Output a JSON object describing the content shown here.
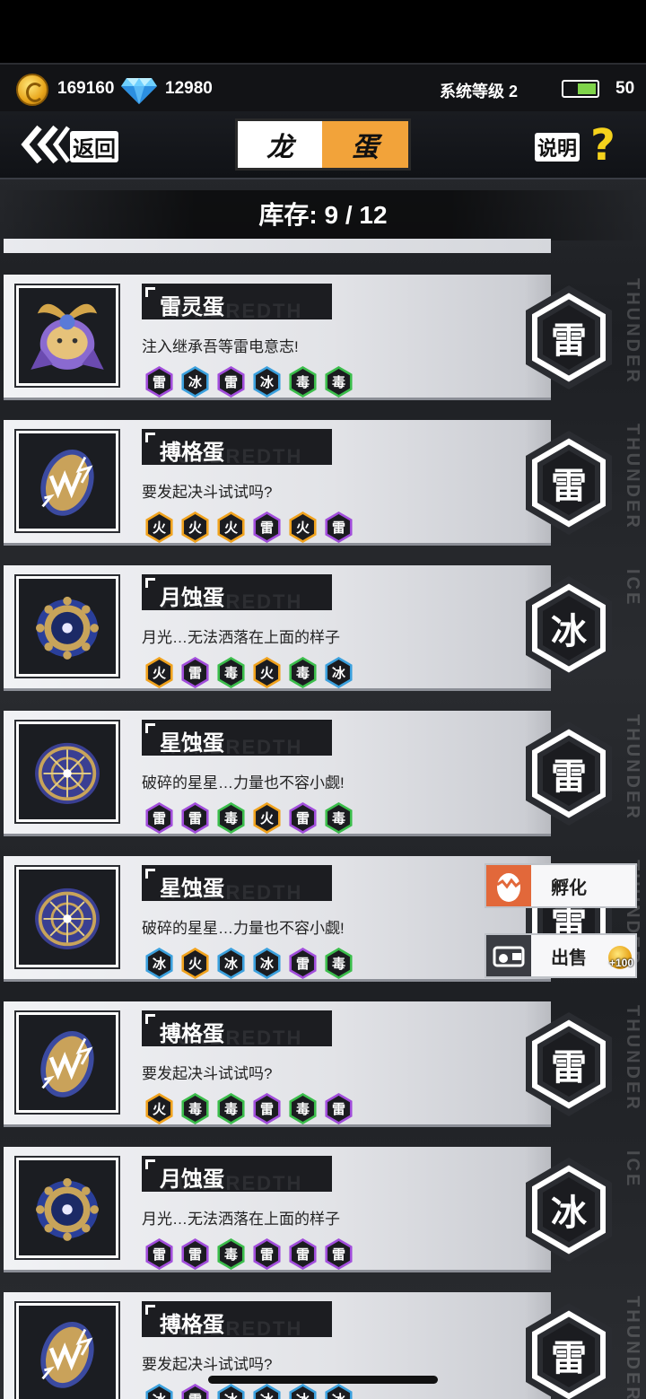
{
  "resources": {
    "coins": "169160",
    "gems": "12980",
    "system_level": "系统等级 2",
    "stamina": "50"
  },
  "nav": {
    "back_label": "返回",
    "title_left": "龙",
    "title_right": "蛋",
    "help_label": "说明",
    "help_mark": "?"
  },
  "stock": "库存: 9 / 12",
  "cards": [
    {
      "name": "雷灵蛋",
      "desc": "注入继承吾等雷电意志!",
      "attrs": [
        "雷",
        "冰",
        "雷",
        "冰",
        "毒",
        "毒"
      ],
      "element": "雷",
      "side": "THUNDER",
      "egg": "samurai"
    },
    {
      "name": "搏格蛋",
      "desc": "要发起决斗试试吗?",
      "attrs": [
        "火",
        "火",
        "火",
        "雷",
        "火",
        "雷"
      ],
      "element": "雷",
      "side": "THUNDER",
      "egg": "combat"
    },
    {
      "name": "月蚀蛋",
      "desc": "月光…无法洒落在上面的样子",
      "attrs": [
        "火",
        "雷",
        "毒",
        "火",
        "毒",
        "冰"
      ],
      "element": "冰",
      "side": "ICE",
      "egg": "moon"
    },
    {
      "name": "星蚀蛋",
      "desc": "破碎的星星…力量也不容小觑!",
      "attrs": [
        "雷",
        "雷",
        "毒",
        "火",
        "雷",
        "毒"
      ],
      "element": "雷",
      "side": "THUNDER",
      "egg": "star"
    },
    {
      "name": "星蚀蛋",
      "desc": "破碎的星星…力量也不容小觑!",
      "attrs": [
        "冰",
        "火",
        "冰",
        "冰",
        "雷",
        "毒"
      ],
      "element": "雷",
      "side": "THUNDER",
      "egg": "star"
    },
    {
      "name": "搏格蛋",
      "desc": "要发起决斗试试吗?",
      "attrs": [
        "火",
        "毒",
        "毒",
        "雷",
        "毒",
        "雷"
      ],
      "element": "雷",
      "side": "THUNDER",
      "egg": "combat"
    },
    {
      "name": "月蚀蛋",
      "desc": "月光…无法洒落在上面的样子",
      "attrs": [
        "雷",
        "雷",
        "毒",
        "雷",
        "雷",
        "雷"
      ],
      "element": "冰",
      "side": "ICE",
      "egg": "moon"
    },
    {
      "name": "搏格蛋",
      "desc": "要发起决斗试试吗?",
      "attrs": [
        "冰",
        "雷",
        "冰",
        "冰",
        "冰",
        "冰"
      ],
      "element": "雷",
      "side": "THUNDER",
      "egg": "combat"
    }
  ],
  "context_menu": {
    "hatch_label": "孵化",
    "sell_label": "出售",
    "sell_price": "+100"
  },
  "colors": {
    "fire": "#f0a21d",
    "thunder": "#a14ddb",
    "ice": "#3ba0dd",
    "poison": "#3bbd4b",
    "title_accent": "#f2a33a",
    "help_accent": "#f5d21c"
  }
}
